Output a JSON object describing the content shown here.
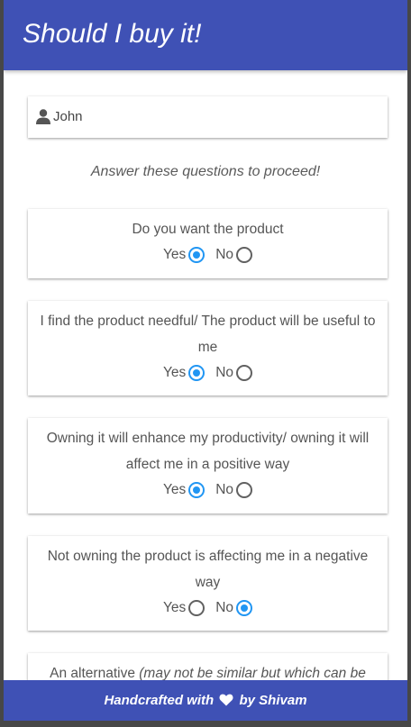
{
  "header": {
    "title": "Should I buy it!"
  },
  "name_field": {
    "icon": "user-icon",
    "value": "John"
  },
  "instruction": "Answer these questions to proceed!",
  "questions": [
    {
      "text": "Do you want the product",
      "yes_label": "Yes",
      "no_label": "No",
      "selected": "yes"
    },
    {
      "text": "I find the product needful/ The product will be useful to me",
      "yes_label": "Yes",
      "no_label": "No",
      "selected": "yes"
    },
    {
      "text": "Owning it will enhance my productivity/ owning it will affect me in a positive way",
      "yes_label": "Yes",
      "no_label": "No",
      "selected": "yes"
    },
    {
      "text": "Not owning the product is affecting me in a negative way",
      "yes_label": "Yes",
      "no_label": "No",
      "selected": "no"
    },
    {
      "text": "An alternative ",
      "text_italic": "(may not be similar but which can be"
    }
  ],
  "footer": {
    "prefix": "Handcrafted with",
    "icon": "heart-icon",
    "suffix": "by Shivam"
  },
  "colors": {
    "primary": "#3f51b5",
    "radio_checked": "#2196f3",
    "radio_unchecked": "#616161"
  }
}
